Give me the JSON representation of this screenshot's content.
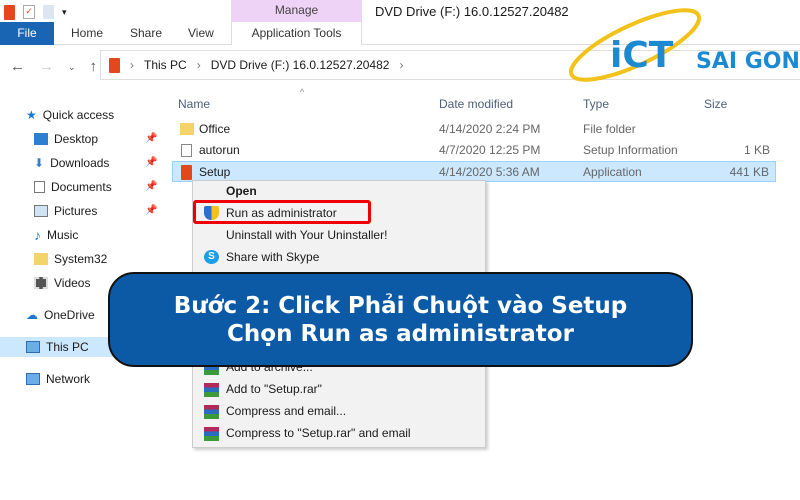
{
  "window": {
    "title": "DVD Drive (F:) 16.0.12527.20482",
    "context_tab": "Manage"
  },
  "ribbon": {
    "tabs": [
      "File",
      "Home",
      "Share",
      "View",
      "Application Tools"
    ]
  },
  "address": {
    "crumbs": [
      "This PC",
      "DVD Drive (F:) 16.0.12527.20482"
    ]
  },
  "sidebar": {
    "items": [
      {
        "label": "Quick access",
        "icon": "star-icon"
      },
      {
        "label": "Desktop",
        "icon": "desktop-icon",
        "pinned": true
      },
      {
        "label": "Downloads",
        "icon": "download-icon",
        "pinned": true
      },
      {
        "label": "Documents",
        "icon": "documents-icon",
        "pinned": true
      },
      {
        "label": "Pictures",
        "icon": "pictures-icon",
        "pinned": true
      },
      {
        "label": "Music",
        "icon": "music-icon"
      },
      {
        "label": "System32",
        "icon": "folder-icon"
      },
      {
        "label": "Videos",
        "icon": "videos-icon"
      },
      {
        "label": "OneDrive",
        "icon": "cloud-icon"
      },
      {
        "label": "This PC",
        "icon": "computer-icon",
        "selected": true
      },
      {
        "label": "Network",
        "icon": "network-icon"
      }
    ]
  },
  "columns": [
    "Name",
    "Date modified",
    "Type",
    "Size"
  ],
  "files": [
    {
      "name": "Office",
      "date": "4/14/2020 2:24 PM",
      "type": "File folder",
      "size": ""
    },
    {
      "name": "autorun",
      "date": "4/7/2020 12:25 PM",
      "type": "Setup Information",
      "size": "1 KB"
    },
    {
      "name": "Setup",
      "date": "4/14/2020 5:36 AM",
      "type": "Application",
      "size": "441 KB"
    }
  ],
  "context_menu": {
    "top": [
      "Open",
      "Run as administrator",
      "Uninstall with Your Uninstaller!",
      "Share with Skype"
    ],
    "bottom": [
      "Add to archive...",
      "Add to \"Setup.rar\"",
      "Compress and email...",
      "Compress to \"Setup.rar\" and email"
    ]
  },
  "banner": {
    "line1": "Bước 2: Click Phải Chuột vào Setup",
    "line2": "Chọn Run as administrator"
  },
  "logo": {
    "text1": "iCT",
    "text2": "SAI GON"
  },
  "colors": {
    "accent": "#1a64b4",
    "banner": "#0c5aa6",
    "highlight": "#e00000",
    "logo": "#1c8ad0"
  }
}
